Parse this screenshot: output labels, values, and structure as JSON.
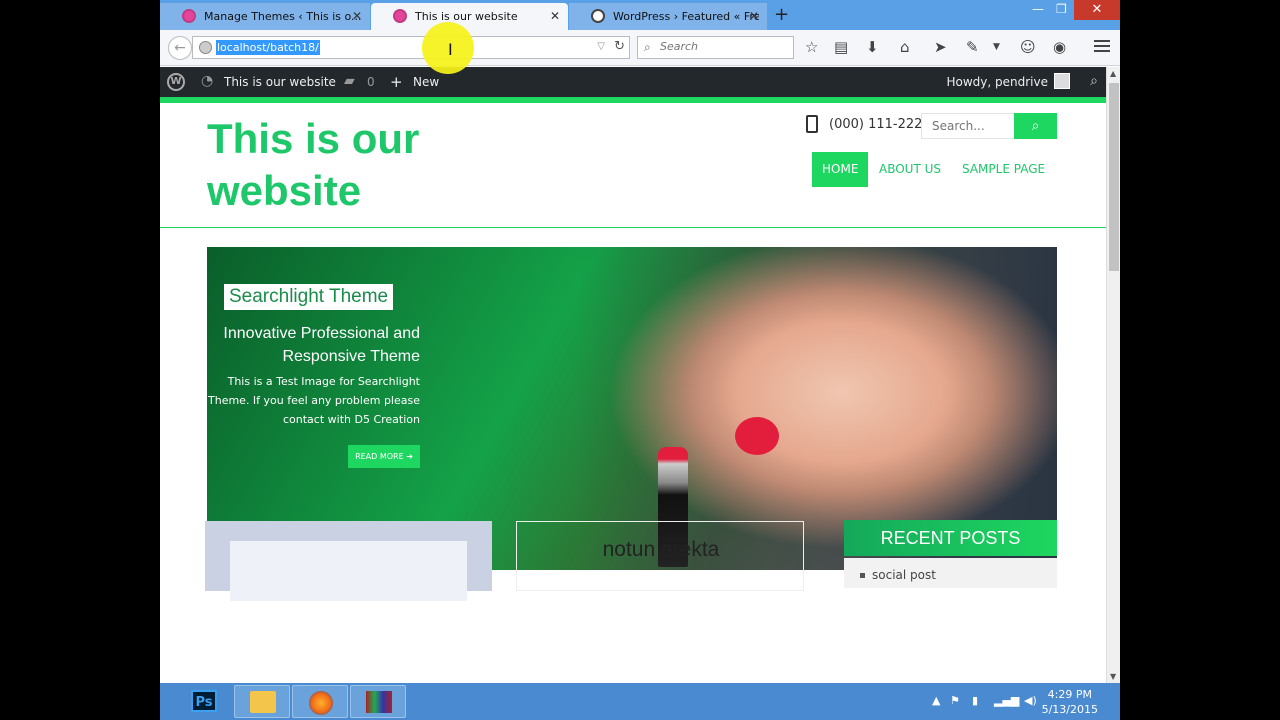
{
  "browser": {
    "tabs": [
      {
        "label": "Manage Themes ‹ This is o...",
        "active": false
      },
      {
        "label": "This is our website",
        "active": true
      },
      {
        "label": "WordPress › Featured « Fre...",
        "active": false
      }
    ],
    "new_tab": "+",
    "url": "localhost/batch18/",
    "search_placeholder": "Search"
  },
  "admin_bar": {
    "site_name": "This is our website",
    "comments_count": "0",
    "new_label": "New",
    "howdy": "Howdy, pendrive"
  },
  "site": {
    "title": "This is our website",
    "phone": "(000) 111-222",
    "search_placeholder": "Search...",
    "menu": [
      "HOME",
      "ABOUT US",
      "SAMPLE PAGE"
    ]
  },
  "slider": {
    "title": "Searchlight Theme",
    "subtitle": "Innovative Professional and Responsive Theme",
    "body": "This is a Test Image for Searchlight Theme. If you feel any problem please contact with D5 Creation",
    "button": "READ MORE"
  },
  "posts": {
    "card_title": "notun arekta",
    "widget_title": "RECENT POSTS",
    "widget_items": [
      "social post"
    ]
  },
  "taskbar": {
    "apps": [
      "Ps"
    ],
    "time": "4:29 PM",
    "date": "5/13/2015"
  },
  "colors": {
    "accent": "#1ed760",
    "title_green": "#1ec76a",
    "admin_bar": "#23282d"
  }
}
